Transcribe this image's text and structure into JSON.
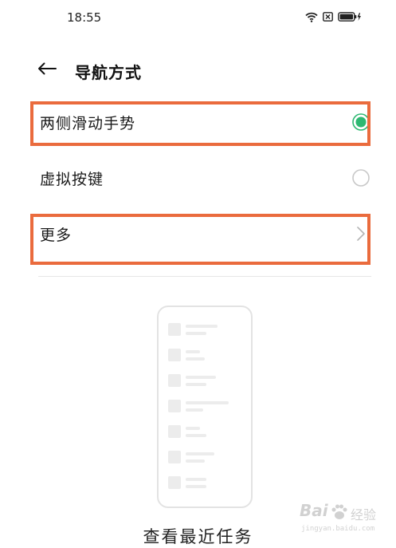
{
  "status_bar": {
    "time": "18:55",
    "icons": [
      "wifi-icon",
      "sim-x-icon",
      "battery-charging-icon"
    ]
  },
  "header": {
    "back_icon": "arrow-left-icon",
    "title": "导航方式"
  },
  "options": [
    {
      "label": "两侧滑动手势",
      "control": "radio",
      "selected": true,
      "highlighted": true
    },
    {
      "label": "虚拟按键",
      "control": "radio",
      "selected": false,
      "highlighted": false
    },
    {
      "label": "更多",
      "control": "chevron-right-icon",
      "highlighted": true
    }
  ],
  "preview": {
    "caption": "查看最近任务"
  },
  "watermark": {
    "brand": "Bai",
    "brand_cn": "经验",
    "url": "jingyan.baidu.com"
  },
  "colors": {
    "accent_green": "#2eb872",
    "highlight_orange": "#ea6b3d",
    "radio_border": "#c8c8c8",
    "placeholder_gray": "#ececec"
  }
}
